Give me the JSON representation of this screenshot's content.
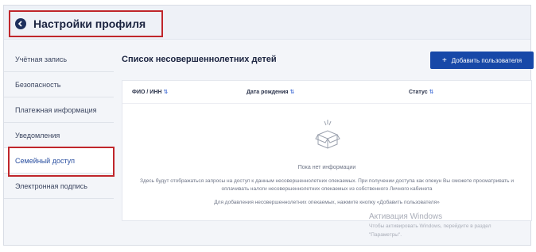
{
  "header": {
    "title": "Настройки профиля",
    "back_icon": "arrow-left-icon"
  },
  "sidebar": {
    "items": [
      {
        "label": "Учётная запись"
      },
      {
        "label": "Безопасность"
      },
      {
        "label": "Платежная информация"
      },
      {
        "label": "Уведомления"
      },
      {
        "label": "Семейный доступ"
      },
      {
        "label": "Электронная подпись"
      }
    ],
    "active_index": 4
  },
  "main": {
    "title": "Список несовершеннолетних детей",
    "add_button": "Добавить пользователя",
    "columns": [
      "ФИО / ИНН",
      "Дата рождения",
      "Статус"
    ],
    "empty": {
      "title": "Пока нет информации",
      "description": "Здесь будут отображаться запросы на доступ к данным несовершеннолетних опекаемых. При получении доступа как опекун Вы сможете просматривать и оплачивать налоги несовершеннолетних опекаемых из собственного Личного кабинета",
      "hint": "Для добавления несовершеннолетних опекаемых, нажмите кнопку «Добавить пользователя»"
    }
  },
  "watermark": {
    "title": "Активация Windows",
    "subtitle_line1": "Чтобы активировать Windows, перейдите в раздел",
    "subtitle_line2": "\"Параметры\"."
  },
  "colors": {
    "accent": "#1748a8",
    "highlight": "#c0262b",
    "navy": "#1d2f5c"
  }
}
